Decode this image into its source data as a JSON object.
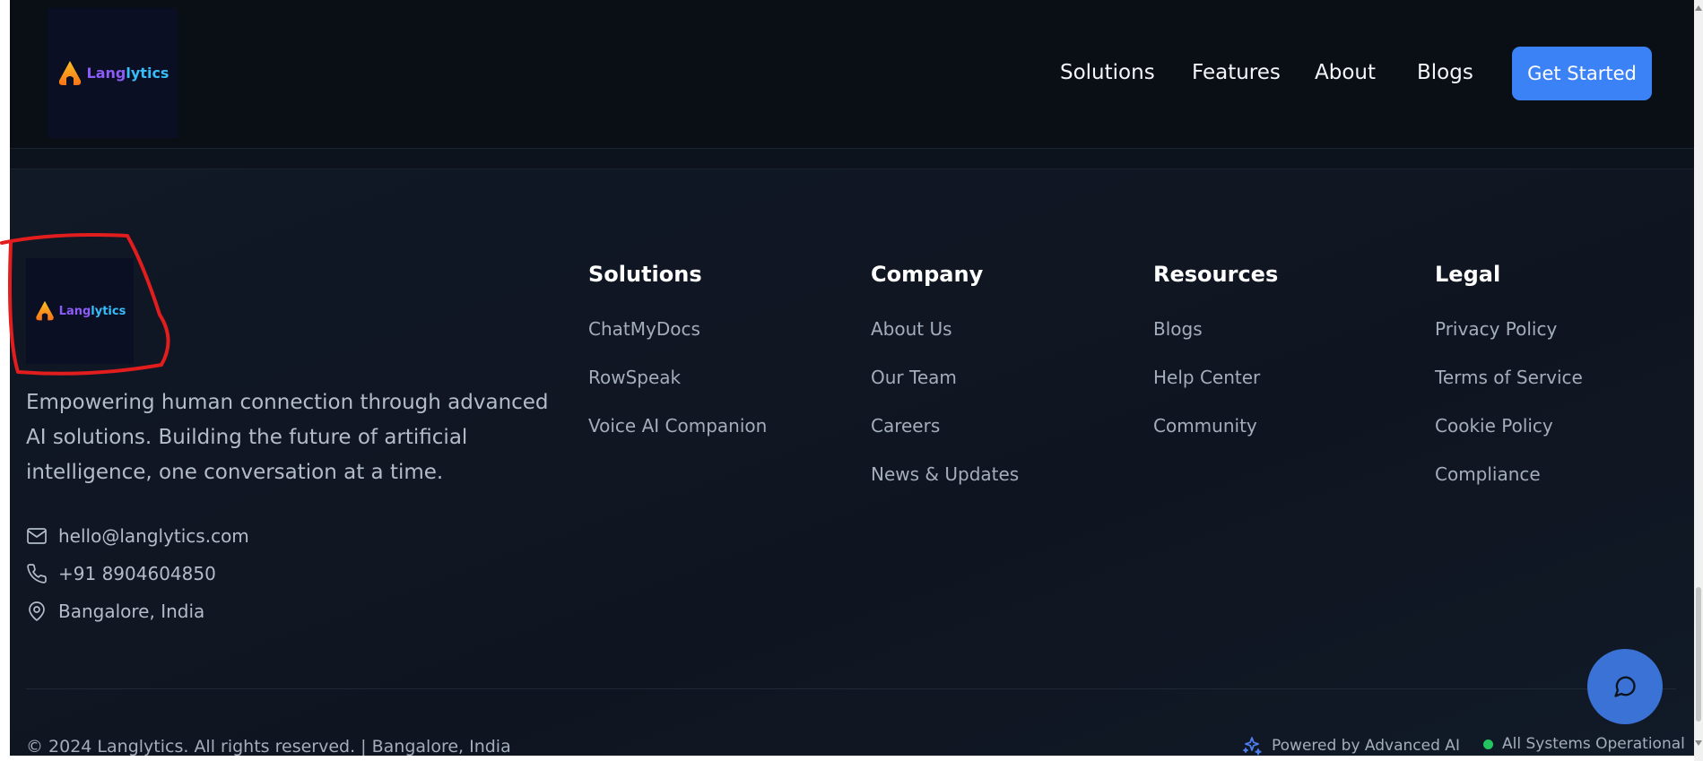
{
  "header": {
    "logo_text_1": "Lang",
    "logo_text_2": "lytics",
    "nav": [
      {
        "label": "Solutions"
      },
      {
        "label": "Features"
      },
      {
        "label": "About"
      },
      {
        "label": "Blogs"
      }
    ],
    "cta_label": "Get Started"
  },
  "footer": {
    "logo_text_1": "Lang",
    "logo_text_2": "lytics",
    "tagline": "Empowering human connection through advanced AI solutions. Building the future of artificial intelligence, one conversation at a time.",
    "contact": {
      "email": "hello@langlytics.com",
      "phone": "+91 8904604850",
      "location": "Bangalore, India"
    },
    "columns": [
      {
        "title": "Solutions",
        "links": [
          "ChatMyDocs",
          "RowSpeak",
          "Voice AI Companion"
        ]
      },
      {
        "title": "Company",
        "links": [
          "About Us",
          "Our Team",
          "Careers",
          "News & Updates"
        ]
      },
      {
        "title": "Resources",
        "links": [
          "Blogs",
          "Help Center",
          "Community"
        ]
      },
      {
        "title": "Legal",
        "links": [
          "Privacy Policy",
          "Terms of Service",
          "Cookie Policy",
          "Compliance"
        ]
      }
    ],
    "copyright": "© 2024 Langlytics. All rights reserved. | Bangalore, India",
    "powered_by": "Powered by Advanced AI",
    "status": "All Systems Operational"
  },
  "icons": {
    "logo": "flame-logo-icon",
    "email": "mail-icon",
    "phone": "phone-icon",
    "location": "map-pin-icon",
    "powered": "sparkles-icon",
    "chat": "message-circle-icon"
  },
  "colors": {
    "accent": "#3b82f6",
    "background": "#0d131c",
    "status_ok": "#22c55e",
    "annotation": "#e11d1d"
  }
}
